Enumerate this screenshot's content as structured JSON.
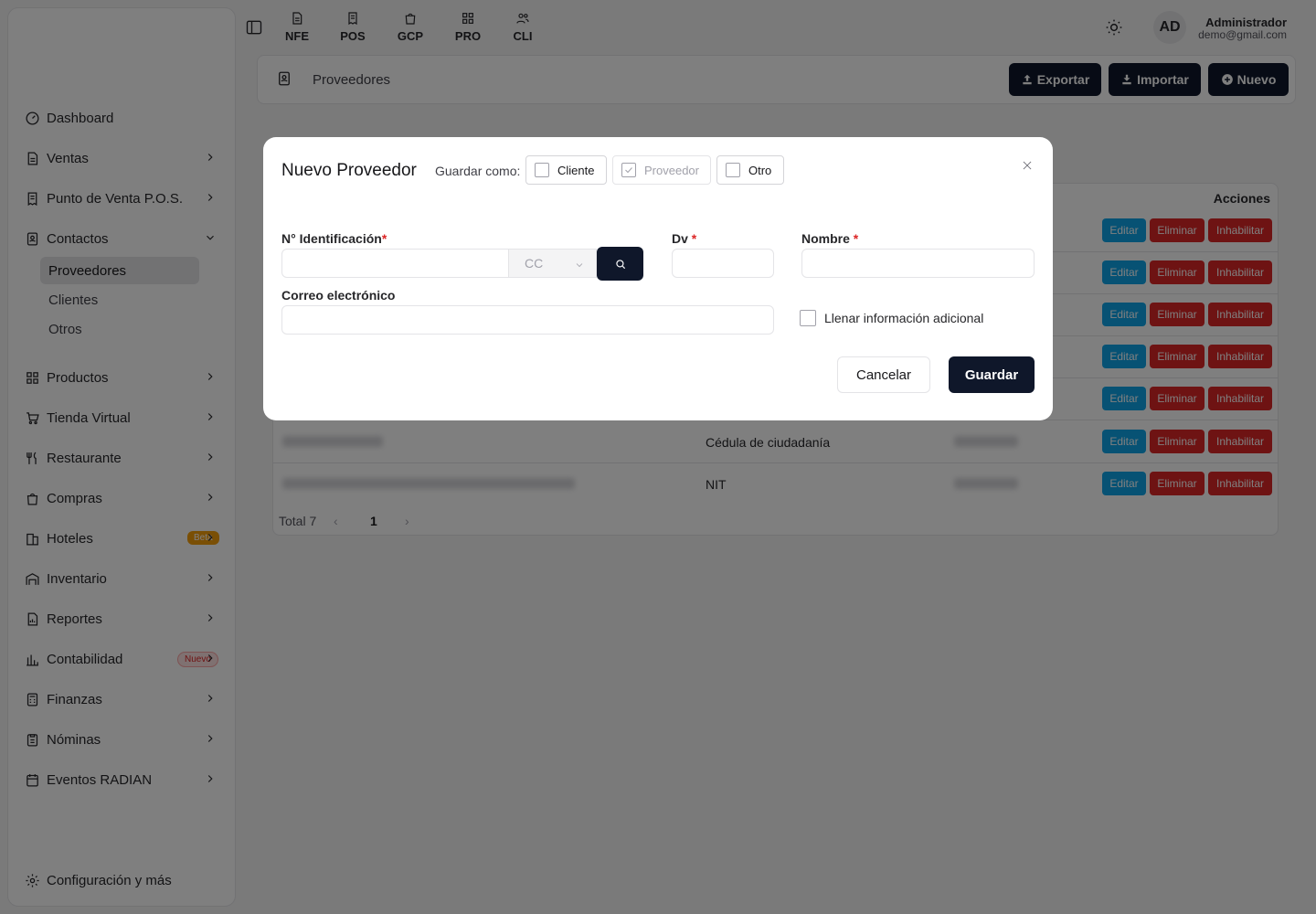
{
  "topbar": {
    "quick_links": [
      {
        "label": "NFE",
        "icon": "document-icon"
      },
      {
        "label": "POS",
        "icon": "receipt-icon"
      },
      {
        "label": "GCP",
        "icon": "bag-icon"
      },
      {
        "label": "PRO",
        "icon": "grid-icon"
      },
      {
        "label": "CLI",
        "icon": "users-icon"
      }
    ],
    "avatar_initials": "AD",
    "user_name": "Administrador",
    "user_email": "demo@gmail.com"
  },
  "sidebar": {
    "items": [
      {
        "label": "Dashboard",
        "icon": "gauge-icon",
        "has_chevron": false
      },
      {
        "label": "Ventas",
        "icon": "file-text-icon",
        "has_chevron": true
      },
      {
        "label": "Punto de Venta P.O.S.",
        "icon": "receipt-icon",
        "has_chevron": true
      },
      {
        "label": "Contactos",
        "icon": "contacts-icon",
        "has_chevron": true,
        "expanded": true
      },
      {
        "label": "Productos",
        "icon": "grid-icon",
        "has_chevron": true
      },
      {
        "label": "Tienda Virtual",
        "icon": "cart-icon",
        "has_chevron": true
      },
      {
        "label": "Restaurante",
        "icon": "utensils-icon",
        "has_chevron": true
      },
      {
        "label": "Compras",
        "icon": "bag-icon",
        "has_chevron": true
      },
      {
        "label": "Hoteles",
        "icon": "hotel-icon",
        "has_chevron": true,
        "badge": "Beta"
      },
      {
        "label": "Inventario",
        "icon": "warehouse-icon",
        "has_chevron": true
      },
      {
        "label": "Reportes",
        "icon": "report-icon",
        "has_chevron": true
      },
      {
        "label": "Contabilidad",
        "icon": "chart-icon",
        "has_chevron": true,
        "badge": "Nuevo"
      },
      {
        "label": "Finanzas",
        "icon": "calculator-icon",
        "has_chevron": true
      },
      {
        "label": "Nóminas",
        "icon": "clipboard-icon",
        "has_chevron": true
      },
      {
        "label": "Eventos RADIAN",
        "icon": "calendar-icon",
        "has_chevron": true
      }
    ],
    "sub_items": [
      "Proveedores",
      "Clientes",
      "Otros"
    ],
    "active_sub": "Proveedores",
    "settings_label": "Configuración y más"
  },
  "header": {
    "title": "Proveedores",
    "export_label": "Exportar",
    "import_label": "Importar",
    "new_label": "Nuevo"
  },
  "table": {
    "actions_header": "Acciones",
    "rows": [
      {
        "doc_type": "",
        "visible": false
      },
      {
        "doc_type": "",
        "visible": false
      },
      {
        "doc_type": "",
        "visible": false
      },
      {
        "doc_type": "",
        "visible": false
      },
      {
        "doc_type": "",
        "visible": false
      },
      {
        "doc_type": "Cédula de ciudadanía",
        "visible": true
      },
      {
        "doc_type": "NIT",
        "visible": true
      }
    ],
    "edit_label": "Editar",
    "delete_label": "Eliminar",
    "disable_label": "Inhabilitar",
    "total_label": "Total 7",
    "current_page": "1"
  },
  "modal": {
    "title": "Nuevo Proveedor",
    "save_as_label": "Guardar como:",
    "options": [
      {
        "label": "Cliente",
        "checked": false,
        "disabled": false
      },
      {
        "label": "Proveedor",
        "checked": true,
        "disabled": true
      },
      {
        "label": "Otro",
        "checked": false,
        "disabled": false
      }
    ],
    "id_label": "N° Identificación",
    "id_value": "",
    "doc_type_value": "CC",
    "dv_label": "Dv",
    "dv_value": "",
    "name_label": "Nombre",
    "name_value": "",
    "email_label": "Correo electrónico",
    "email_value": "",
    "extra_info_label": "Llenar información adicional",
    "extra_info_checked": false,
    "cancel_label": "Cancelar",
    "save_label": "Guardar",
    "required_mark": "*"
  },
  "colors": {
    "primary_dark": "#0f172a",
    "edit_blue": "#0ea5e9",
    "danger_red": "#dc2626",
    "beta_orange": "#f59e0b"
  }
}
